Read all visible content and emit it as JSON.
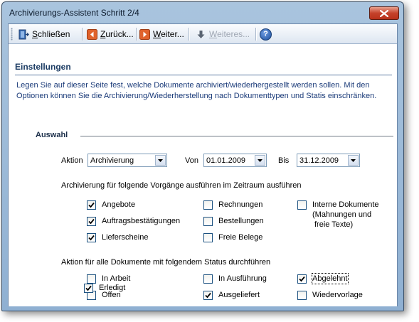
{
  "window": {
    "title": "Archivierungs-Assistent Schritt 2/4"
  },
  "toolbar": {
    "close_label": "Schließen",
    "back_label": "Zurück...",
    "next_label": "Weiter...",
    "more_label": "Weiteres...",
    "help_label": "?"
  },
  "settings": {
    "title": "Einstellungen",
    "intro": "Legen Sie auf dieser Seite fest, welche Dokumente archiviert/wiederhergestellt werden sollen. Mit den Optionen können Sie die Archivierung/Wiederherstellung nach Dokumenttypen und Statis einschränken."
  },
  "selection": {
    "title": "Auswahl",
    "action_label": "Aktion",
    "action_value": "Archivierung",
    "from_label": "Von",
    "from_value": "01.01.2009",
    "to_label": "Bis",
    "to_value": "31.12.2009"
  },
  "transactions": {
    "heading": "Archivierung für folgende Vorgänge ausführen im Zeitraum ausführen",
    "items": [
      {
        "label": "Angebote",
        "checked": true
      },
      {
        "label": "Auftragsbestätigungen",
        "checked": true
      },
      {
        "label": "Lieferscheine",
        "checked": true
      },
      {
        "label": "Rechnungen",
        "checked": false
      },
      {
        "label": "Bestellungen",
        "checked": false
      },
      {
        "label": "Freie Belege",
        "checked": false
      },
      {
        "label": "Interne Dokumente",
        "label_line2": "(Mahnungen und",
        "label_line3": "freie Texte)",
        "checked": false
      }
    ]
  },
  "status": {
    "heading": "Aktion für alle Dokumente mit folgendem Status durchführen",
    "items": [
      {
        "label": "In Arbeit",
        "checked": false
      },
      {
        "label": "Offen",
        "checked": false
      },
      {
        "label": "Erledigt",
        "checked": true
      },
      {
        "label": "In Ausführung",
        "checked": false
      },
      {
        "label": "Ausgeliefert",
        "checked": true
      },
      {
        "label": "Abgelehnt",
        "checked": true
      },
      {
        "label": "Wiedervorlage",
        "checked": false
      }
    ]
  },
  "colors": {
    "accent": "#1b3b79",
    "window_frame": "#8fb0d2",
    "close_button": "#c5422b"
  }
}
